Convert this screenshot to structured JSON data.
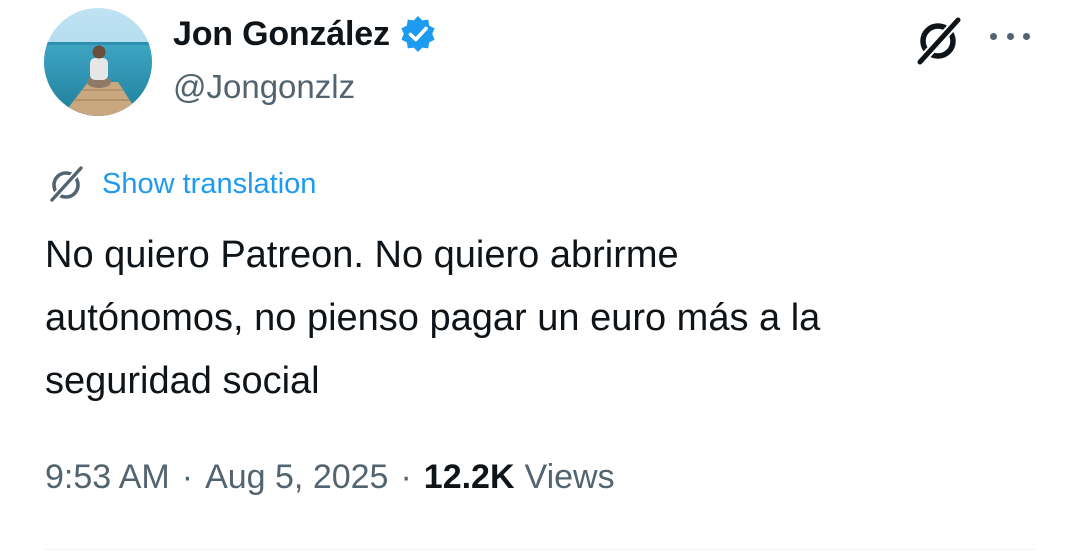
{
  "author": {
    "display_name": "Jon González",
    "handle": "@Jongonzlz",
    "verified": true,
    "verified_badge_color": "#1d9bf0"
  },
  "actions": {
    "grok_icon": "grok-icon",
    "more_icon": "more-horizontal-icon"
  },
  "translation": {
    "label": "Show translation",
    "icon": "grok-icon",
    "color": "#1d9bf0"
  },
  "tweet": {
    "text": "No quiero Patreon. No quiero abrirme\nautónomos, no pienso pagar un euro más a la\nseguridad social"
  },
  "meta": {
    "time": "9:53 AM",
    "separator": "·",
    "date": "Aug 5, 2025",
    "views_count": "12.2K",
    "views_label": "Views"
  },
  "colors": {
    "text_primary": "#0f1419",
    "text_secondary": "#536471",
    "accent": "#1d9bf0",
    "divider": "#eff3f4"
  }
}
